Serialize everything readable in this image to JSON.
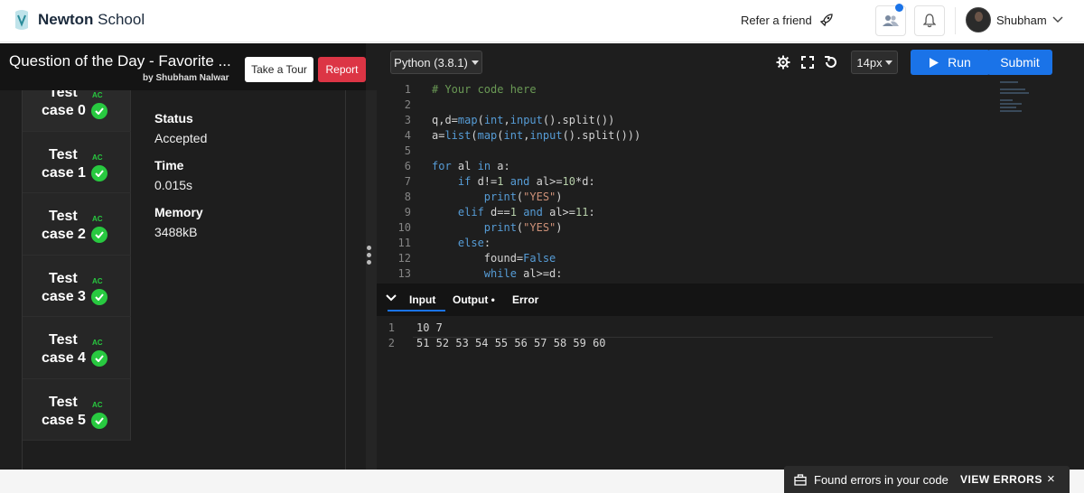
{
  "navbar": {
    "brand_strong": "Newton",
    "brand_light": " School",
    "refer_label": "Refer a friend",
    "user_name": "Shubham"
  },
  "question": {
    "title": "Question of the Day - Favorite ...",
    "author": "by Shubham Nalwar",
    "tour_label": "Take a Tour",
    "report_label": "Report"
  },
  "testcases": [
    {
      "line1": "Test",
      "badge": "AC",
      "line2": "case 0"
    },
    {
      "line1": "Test",
      "badge": "AC",
      "line2": "case 1"
    },
    {
      "line1": "Test",
      "badge": "AC",
      "line2": "case 2"
    },
    {
      "line1": "Test",
      "badge": "AC",
      "line2": "case 3"
    },
    {
      "line1": "Test",
      "badge": "AC",
      "line2": "case 4"
    },
    {
      "line1": "Test",
      "badge": "AC",
      "line2": "case 5"
    }
  ],
  "details": {
    "status_label": "Status",
    "status_value": "Accepted",
    "time_label": "Time",
    "time_value": "0.015s",
    "memory_label": "Memory",
    "memory_value": "3488kB"
  },
  "editor": {
    "language": "Python (3.8.1)",
    "font_size": "14px",
    "run_label": "Run",
    "submit_label": "Submit",
    "code_lines": [
      {
        "n": "1",
        "text": "# Your code here"
      },
      {
        "n": "2",
        "text": ""
      },
      {
        "n": "3",
        "text": "q,d=map(int,input().split())"
      },
      {
        "n": "4",
        "text": "a=list(map(int,input().split()))"
      },
      {
        "n": "5",
        "text": ""
      },
      {
        "n": "6",
        "text": "for al in a:"
      },
      {
        "n": "7",
        "text": "    if d!=1 and al>=10*d:"
      },
      {
        "n": "8",
        "text": "        print(\"YES\")"
      },
      {
        "n": "9",
        "text": "    elif d==1 and al>=11:"
      },
      {
        "n": "10",
        "text": "        print(\"YES\")"
      },
      {
        "n": "11",
        "text": "    else:"
      },
      {
        "n": "12",
        "text": "        found=False"
      },
      {
        "n": "13",
        "text": "        while al>=d:"
      }
    ]
  },
  "io": {
    "tab_input": "Input",
    "tab_output": "Output",
    "tab_error": "Error",
    "lines": [
      {
        "n": "1",
        "text": "10 7"
      },
      {
        "n": "2",
        "text": "51 52 53 54 55 56 57 58 59 60"
      }
    ]
  },
  "toast": {
    "message": "Found errors in your code",
    "action": "VIEW ERRORS",
    "close": "×"
  },
  "colors": {
    "accent": "#1a73e8",
    "report": "#dc3545",
    "success": "#28c940"
  }
}
